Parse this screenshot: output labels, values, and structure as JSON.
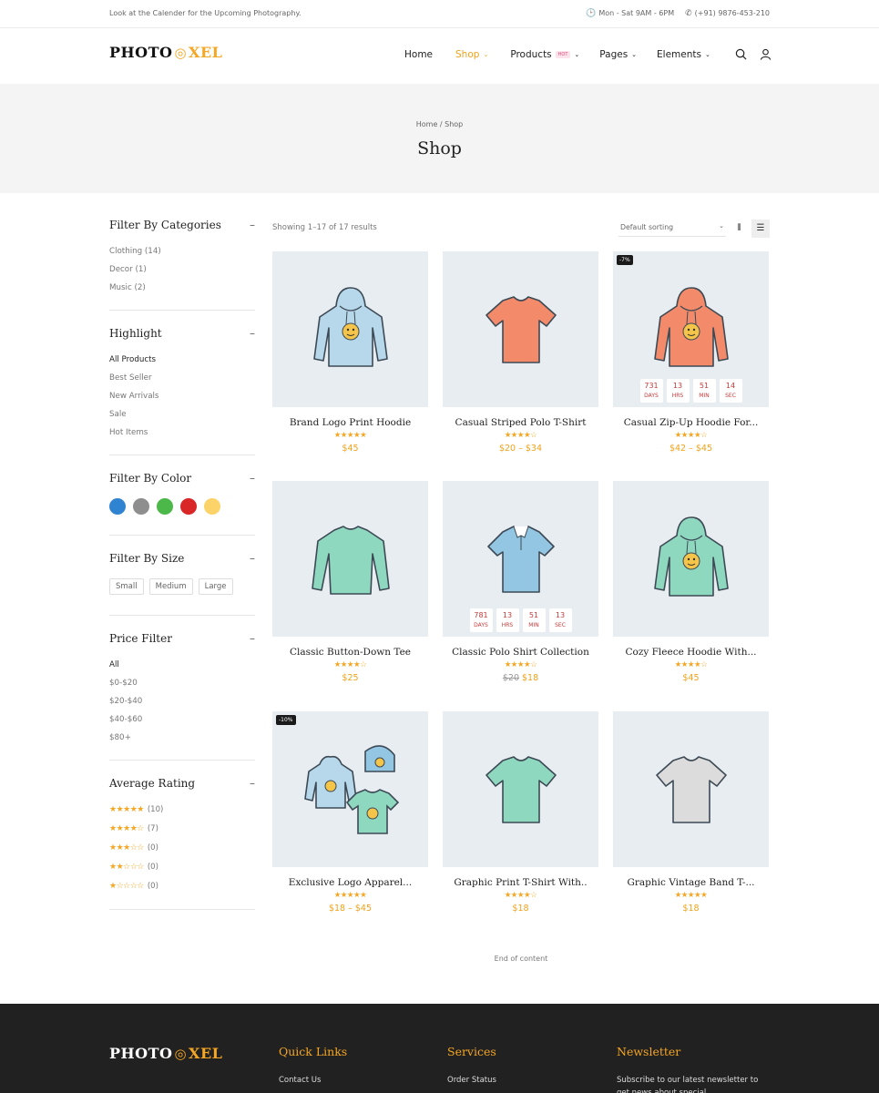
{
  "topbar": {
    "message": "Look at the Calender for the Upcoming Photography.",
    "hours": "Mon - Sat 9AM - 6PM",
    "phone": "(+91) 9876-453-210"
  },
  "logo": {
    "part1": "PHOTO",
    "part2": "XEL"
  },
  "nav": [
    {
      "label": "Home"
    },
    {
      "label": "Shop",
      "active": true,
      "dropdown": true
    },
    {
      "label": "Products",
      "badge": "HOT",
      "dropdown": true
    },
    {
      "label": "Pages",
      "dropdown": true
    },
    {
      "label": "Elements",
      "dropdown": true
    }
  ],
  "banner": {
    "breadcrumb": "Home / Shop",
    "title": "Shop"
  },
  "sidebar": {
    "categories": {
      "title": "Filter By Categories",
      "items": [
        "Clothing (14)",
        "Decor (1)",
        "Music (2)"
      ]
    },
    "highlight": {
      "title": "Highlight",
      "items": [
        "All Products",
        "Best Seller",
        "New Arrivals",
        "Sale",
        "Hot Items"
      ]
    },
    "color": {
      "title": "Filter By Color",
      "swatches": [
        "#2f83d0",
        "#8e8e8e",
        "#4db84a",
        "#d92626",
        "#fbd368"
      ]
    },
    "size": {
      "title": "Filter By Size",
      "items": [
        "Small",
        "Medium",
        "Large"
      ]
    },
    "price": {
      "title": "Price Filter",
      "items": [
        "All",
        "$0-$20",
        "$20-$40",
        "$40-$60",
        "$80+"
      ]
    },
    "rating": {
      "title": "Average Rating",
      "items": [
        {
          "stars": "★★★★★",
          "count": "(10)"
        },
        {
          "stars": "★★★★☆",
          "count": "(7)"
        },
        {
          "stars": "★★★☆☆",
          "count": "(0)"
        },
        {
          "stars": "★★☆☆☆",
          "count": "(0)"
        },
        {
          "stars": "★☆☆☆☆",
          "count": "(0)"
        }
      ]
    }
  },
  "toolbar": {
    "results": "Showing 1–17 of 17 results",
    "sort": "Default sorting"
  },
  "products": [
    {
      "name": "Brand Logo Print Hoodie",
      "stars": "★★★★★",
      "price": "$45",
      "color": "#b6d8ea",
      "shape": "hoodie"
    },
    {
      "name": "Casual Striped Polo T-Shirt",
      "stars": "★★★★☆",
      "price": "$20 – $34",
      "color": "#f38a6a",
      "shape": "tee"
    },
    {
      "name": "Casual Zip-Up Hoodie For...",
      "stars": "★★★★☆",
      "price": "$42 – $45",
      "badge": "-7%",
      "timer": [
        "731",
        "13",
        "51",
        "14"
      ],
      "color": "#f38a6a",
      "shape": "hoodie"
    },
    {
      "name": "Classic Button-Down Tee",
      "stars": "★★★★☆",
      "price": "$25",
      "color": "#8ed8bf",
      "shape": "long"
    },
    {
      "name": "Classic Polo Shirt Collection",
      "stars": "★★★★☆",
      "old_price": "$20",
      "price": "$18",
      "timer": [
        "781",
        "13",
        "51",
        "13"
      ],
      "color": "#93c6e3",
      "shape": "polo"
    },
    {
      "name": "Cozy Fleece Hoodie With...",
      "stars": "★★★★☆",
      "price": "$45",
      "color": "#8ed8bf",
      "shape": "hoodie"
    },
    {
      "name": "Exclusive Logo Apparel...",
      "stars": "★★★★★",
      "price": "$18 – $45",
      "badge": "-10%",
      "color": "#b6d8ea",
      "shape": "set"
    },
    {
      "name": "Graphic Print T-Shirt With..",
      "stars": "★★★★☆",
      "price": "$18",
      "color": "#8ed8bf",
      "shape": "tee"
    },
    {
      "name": "Graphic Vintage Band T-...",
      "stars": "★★★★★",
      "price": "$18",
      "color": "#dcdcdc",
      "shape": "tee"
    }
  ],
  "timer_labels": [
    "DAYS",
    "HRS",
    "MIN",
    "SEC"
  ],
  "end_text": "End of content",
  "footer": {
    "quick_links": {
      "title": "Quick Links",
      "first": "Contact Us"
    },
    "services": {
      "title": "Services",
      "first": "Order Status"
    },
    "newsletter": {
      "title": "Newsletter",
      "text": "Subscribe to our latest newsletter to get news about special"
    }
  }
}
